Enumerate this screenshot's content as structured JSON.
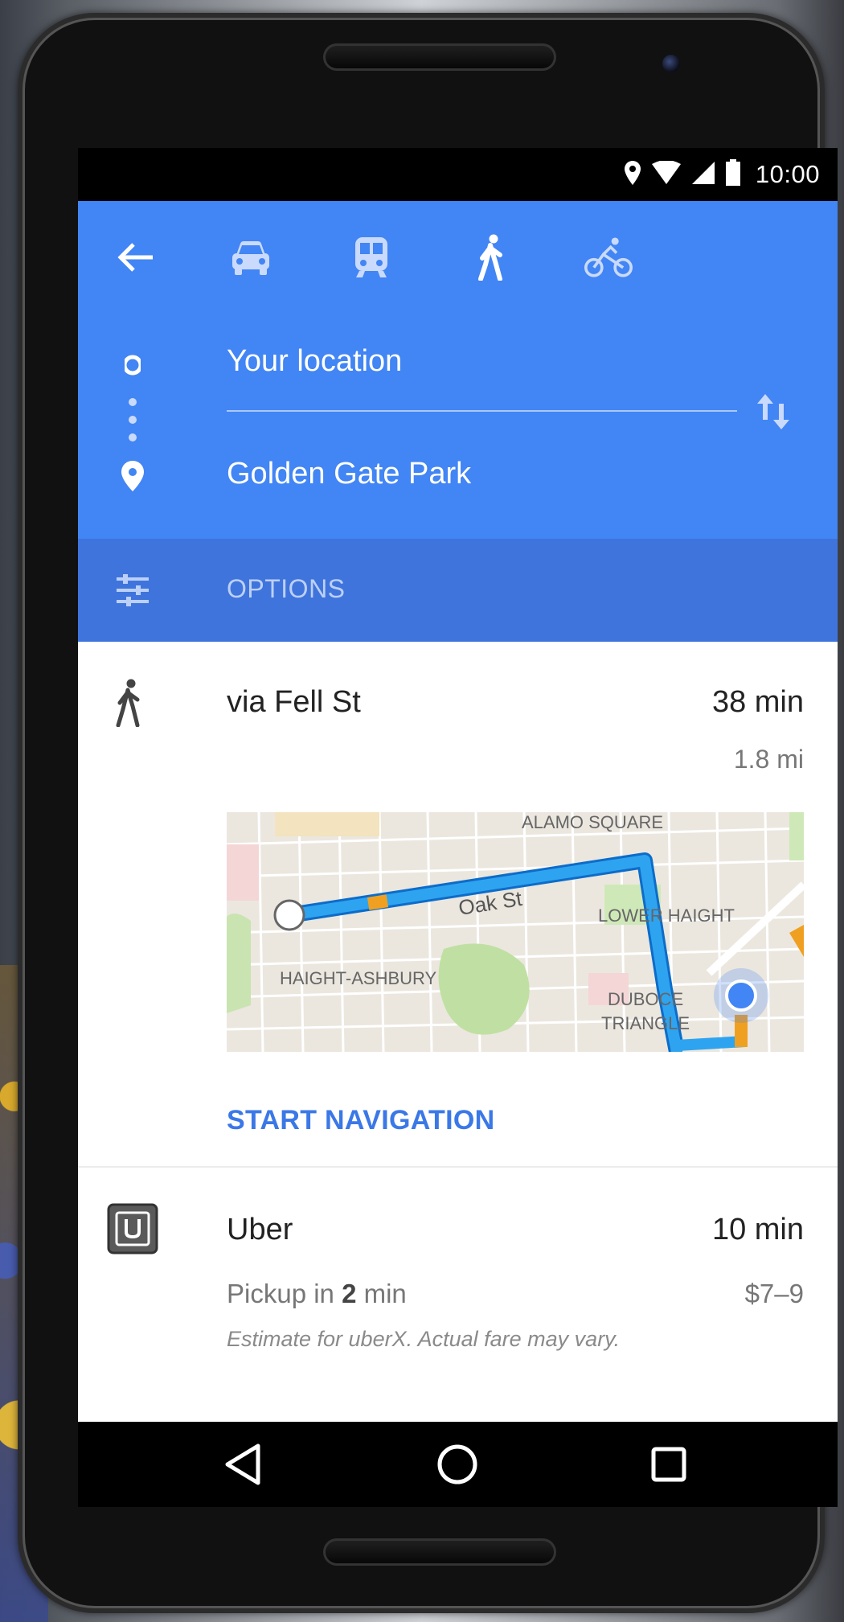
{
  "status_bar": {
    "time": "10:00"
  },
  "travel_modes": [
    {
      "icon": "car-icon"
    },
    {
      "icon": "transit-icon"
    },
    {
      "icon": "walk-icon",
      "selected": true
    },
    {
      "icon": "bike-icon"
    }
  ],
  "route": {
    "origin": "Your location",
    "destination": "Golden Gate Park"
  },
  "options": {
    "label": "OPTIONS"
  },
  "walk_option": {
    "via": "via Fell St",
    "duration": "38 min",
    "distance": "1.8 mi",
    "map_labels": {
      "alamo_square": "ALAMO SQUARE",
      "oak_st": "Oak St",
      "lower_haight": "LOWER HAIGHT",
      "haight_ashbury": "HAIGHT-ASHBURY",
      "duboce_1": "DUBOCE",
      "duboce_2": "TRIANGLE"
    },
    "start_navigation": "START NAVIGATION"
  },
  "uber_option": {
    "name": "Uber",
    "duration": "10 min",
    "pickup_prefix": "Pickup in ",
    "pickup_number": "2",
    "pickup_suffix": " min",
    "price": "$7–9",
    "note": "Estimate for uberX. Actual fare may vary."
  },
  "colors": {
    "header_blue": "#4285f4",
    "options_blue": "#3f74dc",
    "route_blue": "#2196f3",
    "accent": "#3b78e7"
  }
}
